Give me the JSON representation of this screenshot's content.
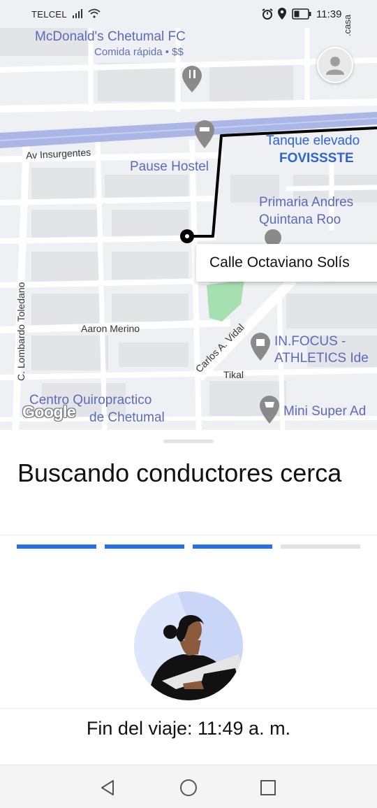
{
  "status_bar": {
    "carrier": "TELCEL",
    "time": "11:39"
  },
  "map": {
    "places": {
      "mcdonalds_name": "McDonald's Chetumal FC",
      "mcdonalds_sub": "Comida rápida • $$",
      "casa": ".casa",
      "tanque_line1": "Tanque elevado",
      "tanque_line2": "FOVISSSTE",
      "pause_hostel": "Pause Hostel",
      "primaria_line1": "Primaria Andres",
      "primaria_line2": "Quintana Roo",
      "infocus_line1": "IN.FOCUS -",
      "infocus_line2": "ATHLETICS Ide",
      "quiro_line1": "Centro Quiropractico",
      "quiro_line2": "de Chetumal",
      "mini_super": "Mini Super Ad"
    },
    "streets": {
      "insurgentes": "Av Insurgentes",
      "toledano": "C. Lombardo Toledano",
      "aaron_merino": "Aaron Merino",
      "carlos_vidal": "Carlos A. Vidal",
      "tikal": "Tikal"
    },
    "pickup_callout": "Calle Octaviano Solís",
    "google_logo": "Google",
    "route_color": "#000000",
    "road_color": "#ffffff",
    "highway_color": "#a9b6e6"
  },
  "sheet": {
    "title": "Buscando conductores cerca",
    "progress": {
      "total_segments": 4,
      "filled_segments": 3,
      "active_color": "#276ef1",
      "inactive_color": "#e2e2e2"
    },
    "eta": "Fin del viaje: 11:49 a. m."
  },
  "nav": {
    "back": "back-icon",
    "home": "home-icon",
    "recents": "recents-icon"
  }
}
